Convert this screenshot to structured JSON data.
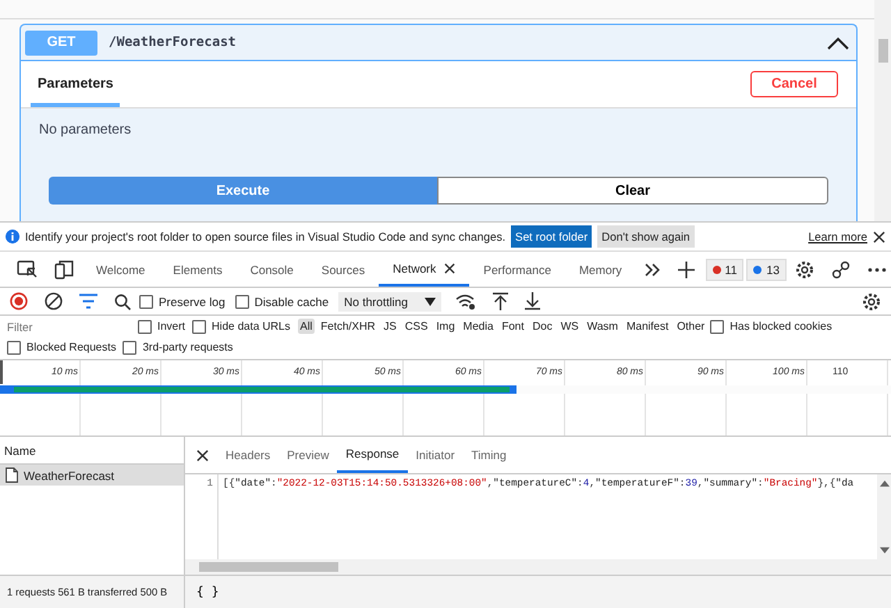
{
  "operation": {
    "method": "GET",
    "path": "/WeatherForecast",
    "expanded": true,
    "tab": "Parameters",
    "cancel": "Cancel",
    "message": "No parameters",
    "execute": "Execute",
    "clear": "Clear"
  },
  "infobar": {
    "text": "Identify your project's root folder to open source files in Visual Studio Code and sync changes.",
    "primary": "Set root folder",
    "secondary": "Don't show again",
    "link": "Learn more"
  },
  "devtools_tabs": [
    {
      "label": "Welcome",
      "selected": false
    },
    {
      "label": "Elements",
      "selected": false
    },
    {
      "label": "Console",
      "selected": false
    },
    {
      "label": "Sources",
      "selected": false
    },
    {
      "label": "Network",
      "selected": true
    },
    {
      "label": "Performance",
      "selected": false
    },
    {
      "label": "Memory",
      "selected": false
    }
  ],
  "counters": {
    "errors": "11",
    "messages": "13"
  },
  "toolbar": {
    "recording": true,
    "preserve_log": {
      "label": "Preserve log",
      "checked": false
    },
    "disable_cache": {
      "label": "Disable cache",
      "checked": false
    },
    "throttling": "No throttling"
  },
  "filter": {
    "placeholder": "Filter",
    "options": [
      {
        "label": "Invert",
        "checked": false
      },
      {
        "label": "Hide data URLs",
        "checked": false
      }
    ],
    "types": [
      {
        "label": "All",
        "selected": true
      },
      {
        "label": "Fetch/XHR",
        "selected": false
      },
      {
        "label": "JS",
        "selected": false
      },
      {
        "label": "CSS",
        "selected": false
      },
      {
        "label": "Img",
        "selected": false
      },
      {
        "label": "Media",
        "selected": false
      },
      {
        "label": "Font",
        "selected": false
      },
      {
        "label": "Doc",
        "selected": false
      },
      {
        "label": "WS",
        "selected": false
      },
      {
        "label": "Wasm",
        "selected": false
      },
      {
        "label": "Manifest",
        "selected": false
      },
      {
        "label": "Other",
        "selected": false
      }
    ],
    "extra": [
      {
        "label": "Has blocked cookies",
        "checked": false
      }
    ],
    "second_row": [
      {
        "label": "Blocked Requests",
        "checked": false
      },
      {
        "label": "3rd-party requests",
        "checked": false
      }
    ]
  },
  "timeline": {
    "ticks": [
      "10 ms",
      "20 ms",
      "30 ms",
      "40 ms",
      "50 ms",
      "60 ms",
      "70 ms",
      "80 ms",
      "90 ms",
      "100 ms",
      "110"
    ],
    "level": 0.58
  },
  "requests": {
    "header": "Name",
    "items": [
      {
        "name": "WeatherForecast",
        "selected": true
      }
    ]
  },
  "detail_tabs": [
    {
      "label": "Headers",
      "selected": false
    },
    {
      "label": "Preview",
      "selected": false
    },
    {
      "label": "Response",
      "selected": true
    },
    {
      "label": "Initiator",
      "selected": false
    },
    {
      "label": "Timing",
      "selected": false
    }
  ],
  "response": {
    "line_number": "1",
    "tokens": [
      {
        "kind": "punct",
        "text": "[{"
      },
      {
        "kind": "key",
        "text": "\"date\""
      },
      {
        "kind": "punct",
        "text": ":"
      },
      {
        "kind": "string",
        "text": "\"2022-12-03T15:14:50.5313326+08:00\""
      },
      {
        "kind": "punct",
        "text": ","
      },
      {
        "kind": "key",
        "text": "\"temperatureC\""
      },
      {
        "kind": "punct",
        "text": ":"
      },
      {
        "kind": "number",
        "text": "4"
      },
      {
        "kind": "punct",
        "text": ","
      },
      {
        "kind": "key",
        "text": "\"temperatureF\""
      },
      {
        "kind": "punct",
        "text": ":"
      },
      {
        "kind": "number",
        "text": "39"
      },
      {
        "kind": "punct",
        "text": ","
      },
      {
        "kind": "key",
        "text": "\"summary\""
      },
      {
        "kind": "punct",
        "text": ":"
      },
      {
        "kind": "string",
        "text": "\"Bracing\""
      },
      {
        "kind": "punct",
        "text": "},{"
      },
      {
        "kind": "key",
        "text": "\"da"
      }
    ]
  },
  "status_bar": {
    "text": "1 requests  561 B transferred  500 B",
    "format_button": "{ }"
  }
}
